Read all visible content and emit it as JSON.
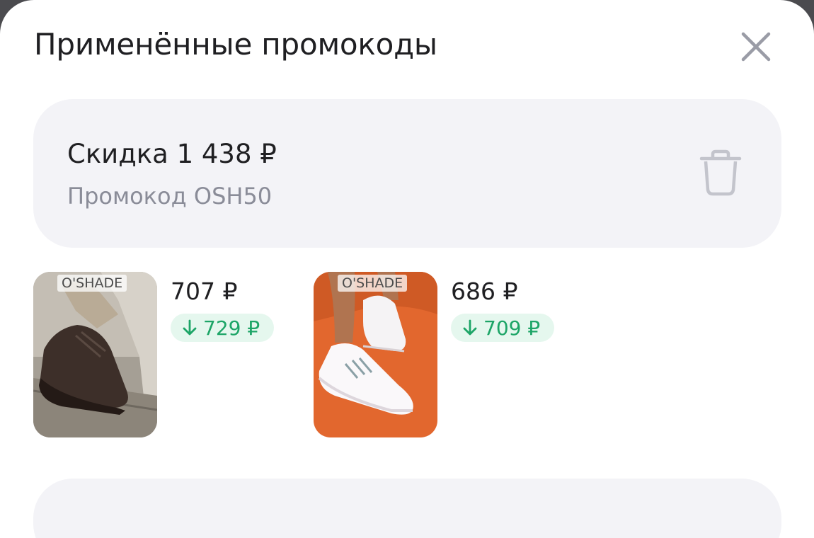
{
  "header": {
    "title": "Применённые промокоды"
  },
  "promo": {
    "discount": "Скидка 1 438 ₽",
    "code": "Промокод OSH50"
  },
  "products": [
    {
      "brand": "O'SHADE",
      "price": "707 ₽",
      "old_price": "729 ₽"
    },
    {
      "brand": "O'SHADE",
      "price": "686 ₽",
      "old_price": "709 ₽"
    }
  ],
  "icons": {
    "close": "close-icon",
    "delete": "trash-icon",
    "price_down": "arrow-down-icon"
  },
  "colors": {
    "card_bg": "#f3f3f7",
    "muted_text": "#8a8c98",
    "discount_green": "#1da567",
    "discount_bg": "#e5f7ee"
  }
}
